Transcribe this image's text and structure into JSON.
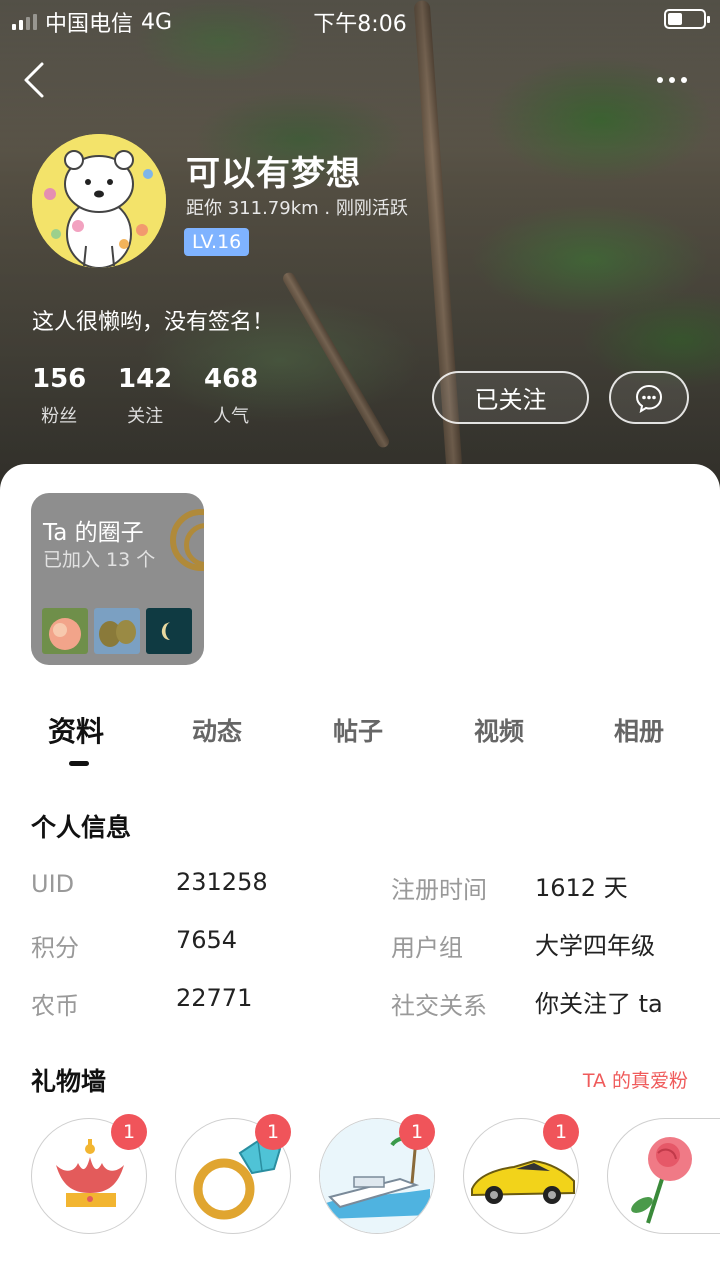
{
  "status_bar": {
    "carrier": "中国电信",
    "network": "4G",
    "time": "下午8:06"
  },
  "profile": {
    "name": "可以有梦想",
    "meta": "距你 311.79km . 刚刚活跃",
    "level": "LV.16",
    "signature": "这人很懒哟，没有签名！",
    "stats": [
      {
        "value": "156",
        "label": "粉丝"
      },
      {
        "value": "142",
        "label": "关注"
      },
      {
        "value": "468",
        "label": "人气"
      }
    ],
    "follow_label": "已关注"
  },
  "circle": {
    "title": "Ta 的圈子",
    "subtitle": "已加入 13 个"
  },
  "tabs": [
    "资料",
    "动态",
    "帖子",
    "视频",
    "相册"
  ],
  "personal_info": {
    "title": "个人信息",
    "rows": [
      {
        "label": "UID",
        "value": "231258"
      },
      {
        "label": "注册时间",
        "value": "1612 天"
      },
      {
        "label": "积分",
        "value": "7654"
      },
      {
        "label": "用户组",
        "value": "大学四年级"
      },
      {
        "label": "农币",
        "value": "22771"
      },
      {
        "label": "社交关系",
        "value": "你关注了 ta"
      }
    ]
  },
  "gift_wall": {
    "title": "礼物墙",
    "link": "TA 的真爱粉",
    "gifts": [
      {
        "icon": "crown-icon",
        "count": "1"
      },
      {
        "icon": "diamond-ring-icon",
        "count": "1"
      },
      {
        "icon": "yacht-icon",
        "count": "1"
      },
      {
        "icon": "sports-car-icon",
        "count": "1"
      },
      {
        "icon": "rose-icon"
      }
    ]
  },
  "colors": {
    "accent_red": "#f0545a",
    "level_blue": "#7fb3ff",
    "link_red": "#ef5b5b"
  }
}
